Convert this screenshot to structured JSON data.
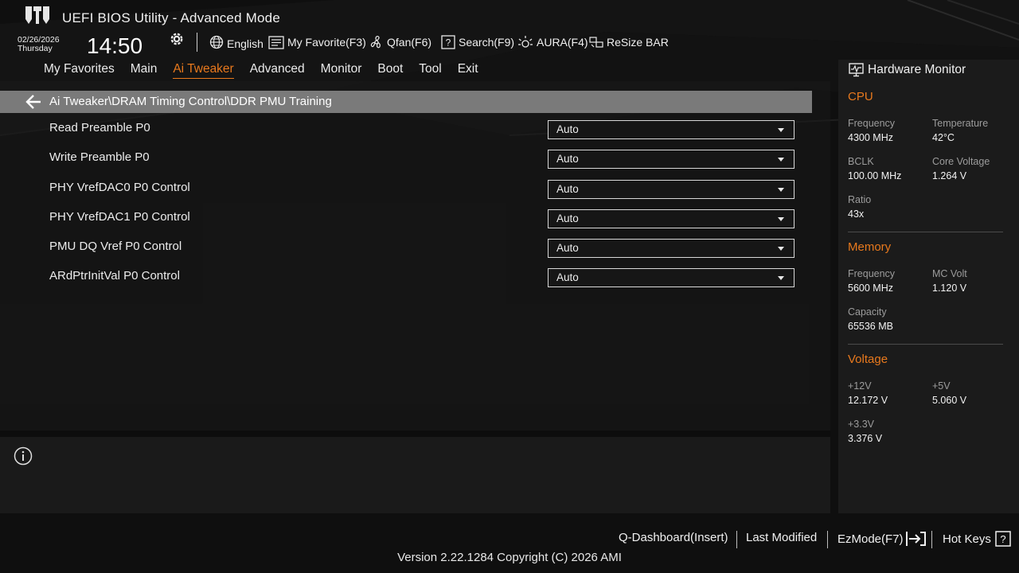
{
  "header": {
    "app_title": "UEFI BIOS Utility - Advanced Mode",
    "date": "02/26/2026",
    "day": "Thursday",
    "time": "14:50",
    "tools": {
      "language": "English",
      "favorites": "My Favorite(F3)",
      "qfan": "Qfan(F6)",
      "search": "Search(F9)",
      "aura": "AURA(F4)",
      "resize_bar": "ReSize BAR"
    }
  },
  "nav": {
    "tabs": [
      "My Favorites",
      "Main",
      "Ai Tweaker",
      "Advanced",
      "Monitor",
      "Boot",
      "Tool",
      "Exit"
    ],
    "active": "Ai Tweaker"
  },
  "breadcrumb": "Ai Tweaker\\DRAM Timing Control\\DDR PMU Training",
  "settings": [
    {
      "label": "Read Preamble P0",
      "value": "Auto"
    },
    {
      "label": "Write Preamble P0",
      "value": "Auto"
    },
    {
      "label": "PHY VrefDAC0 P0 Control",
      "value": "Auto"
    },
    {
      "label": "PHY VrefDAC1 P0 Control",
      "value": "Auto"
    },
    {
      "label": "PMU DQ Vref P0 Control",
      "value": "Auto"
    },
    {
      "label": "ARdPtrInitVal P0 Control",
      "value": "Auto"
    }
  ],
  "hardware_monitor": {
    "title": "Hardware Monitor",
    "cpu": {
      "section": "CPU",
      "frequency_label": "Frequency",
      "frequency": "4300 MHz",
      "temperature_label": "Temperature",
      "temperature": "42°C",
      "bclk_label": "BCLK",
      "bclk": "100.00 MHz",
      "core_voltage_label": "Core Voltage",
      "core_voltage": "1.264 V",
      "ratio_label": "Ratio",
      "ratio": "43x"
    },
    "memory": {
      "section": "Memory",
      "frequency_label": "Frequency",
      "frequency": "5600 MHz",
      "mc_volt_label": "MC Volt",
      "mc_volt": "1.120 V",
      "capacity_label": "Capacity",
      "capacity": "65536 MB"
    },
    "voltage": {
      "section": "Voltage",
      "v12_label": "+12V",
      "v12": "12.172 V",
      "v5_label": "+5V",
      "v5": "5.060 V",
      "v33_label": "+3.3V",
      "v33": "3.376 V"
    }
  },
  "footer": {
    "q_dashboard": "Q-Dashboard(Insert)",
    "last_modified": "Last Modified",
    "ezmode": "EzMode(F7)",
    "hot_keys": "Hot Keys",
    "version": "Version 2.22.1284 Copyright (C) 2026 AMI"
  },
  "colors": {
    "accent": "#e8791d",
    "background": "#0f0f0f",
    "breadcrumb_bar": "#7a7a7a"
  }
}
